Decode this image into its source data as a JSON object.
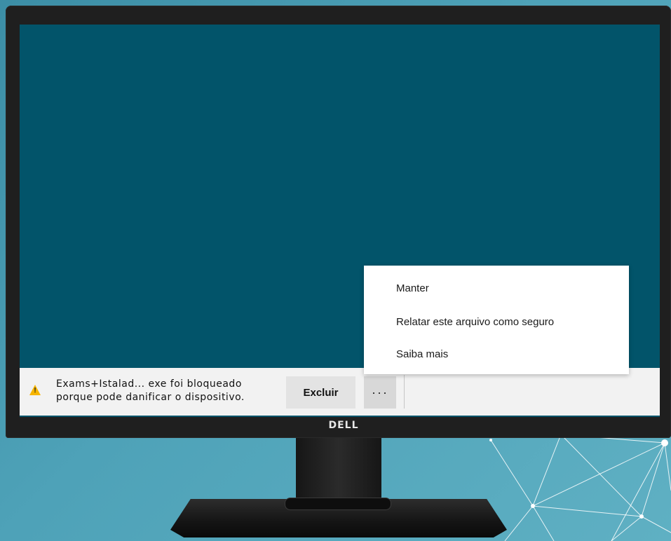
{
  "monitor": {
    "brand": "DELL"
  },
  "download_bar": {
    "warning_icon": "warning-triangle-icon",
    "message_line1": "Exams+Istalad... exe foi bloqueado",
    "message_line2": "porque pode danificar o dispositivo.",
    "delete_label": "Excluir",
    "more_label": "···",
    "more_icon": "more-options-icon"
  },
  "context_menu": {
    "items": [
      {
        "label": "Manter"
      },
      {
        "label": "Relatar este arquivo como seguro"
      },
      {
        "label": "Saiba mais"
      }
    ]
  },
  "colors": {
    "screen": "#02546a",
    "background": "#4ea2b8",
    "warning": "#f7b500",
    "bar": "#f2f2f2"
  }
}
